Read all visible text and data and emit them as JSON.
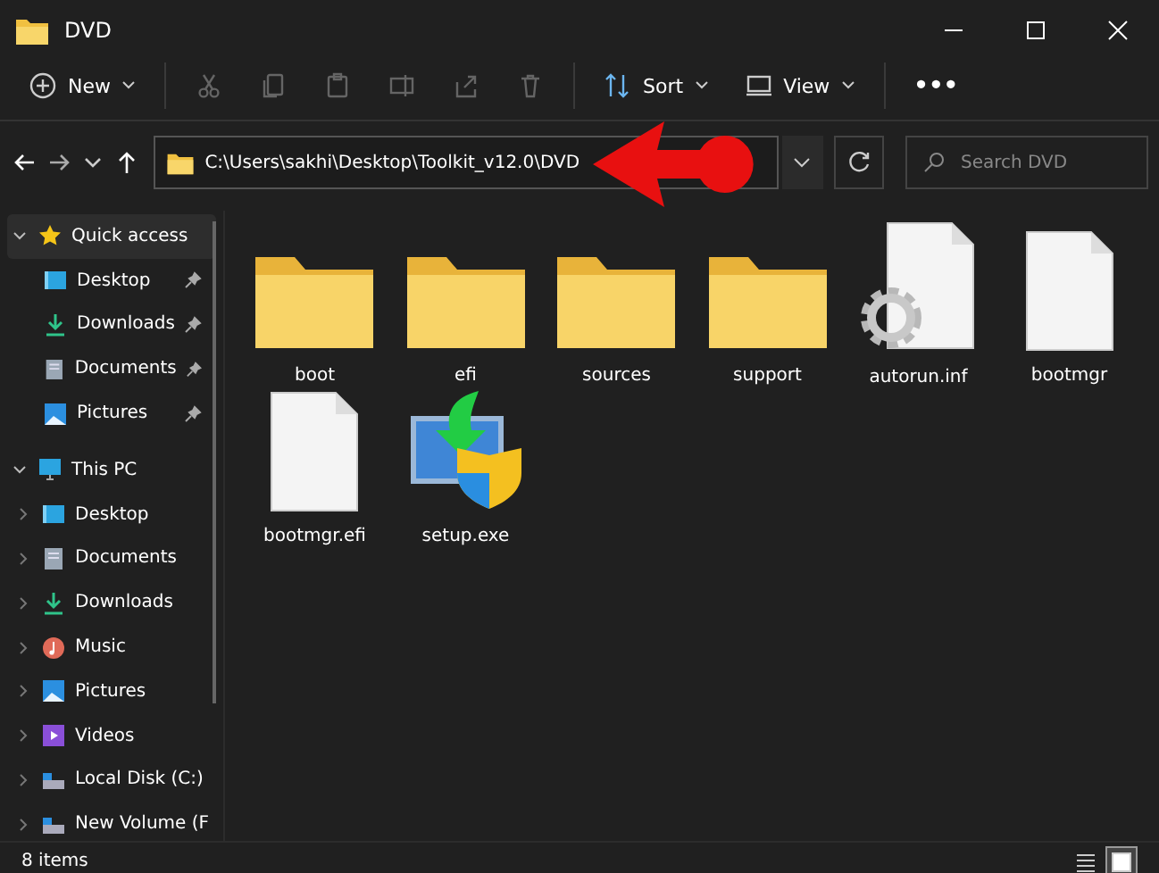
{
  "window": {
    "title": "DVD"
  },
  "toolbar": [
    {
      "kind": "new",
      "label": "New",
      "disabled": false
    },
    {
      "kind": "cut",
      "disabled": true
    },
    {
      "kind": "copy",
      "disabled": true
    },
    {
      "kind": "paste",
      "disabled": true
    },
    {
      "kind": "rename",
      "disabled": true
    },
    {
      "kind": "share",
      "disabled": true
    },
    {
      "kind": "delete",
      "disabled": true
    },
    {
      "kind": "sort",
      "label": "Sort",
      "disabled": false
    },
    {
      "kind": "view",
      "label": "View",
      "disabled": false
    },
    {
      "kind": "more",
      "label": "•••",
      "disabled": false
    }
  ],
  "address": {
    "path": "C:\\Users\\sakhi\\Desktop\\Toolkit_v12.0\\DVD"
  },
  "search": {
    "placeholder": "Search DVD"
  },
  "sidebar": [
    {
      "label": "Quick access",
      "kind": "star",
      "expanded": true,
      "selected": true,
      "children": [
        {
          "label": "Desktop",
          "kind": "desktop",
          "pinned": true,
          "selected": false
        },
        {
          "label": "Downloads",
          "kind": "download",
          "pinned": true,
          "selected": false
        },
        {
          "label": "Documents",
          "kind": "document",
          "pinned": true,
          "selected": false
        },
        {
          "label": "Pictures",
          "kind": "picture",
          "pinned": true,
          "selected": false
        }
      ]
    },
    {
      "label": "This PC",
      "kind": "pc",
      "expanded": true,
      "selected": false,
      "children": [
        {
          "label": "Desktop",
          "kind": "desktop",
          "expanded": false,
          "selected": false
        },
        {
          "label": "Documents",
          "kind": "document",
          "expanded": false,
          "selected": false
        },
        {
          "label": "Downloads",
          "kind": "download",
          "expanded": false,
          "selected": false
        },
        {
          "label": "Music",
          "kind": "music",
          "expanded": false,
          "selected": false
        },
        {
          "label": "Pictures",
          "kind": "picture",
          "expanded": false,
          "selected": false
        },
        {
          "label": "Videos",
          "kind": "video",
          "expanded": false,
          "selected": false
        },
        {
          "label": "Local Disk (C:)",
          "kind": "disk",
          "expanded": false,
          "selected": false
        },
        {
          "label": "New Volume (F",
          "kind": "disk",
          "expanded": false,
          "selected": false
        }
      ]
    }
  ],
  "files": [
    {
      "name": "boot",
      "kind": "folder"
    },
    {
      "name": "efi",
      "kind": "folder"
    },
    {
      "name": "sources",
      "kind": "folder"
    },
    {
      "name": "support",
      "kind": "folder"
    },
    {
      "name": "autorun.inf",
      "kind": "settings"
    },
    {
      "name": "bootmgr",
      "kind": "file"
    },
    {
      "name": "bootmgr.efi",
      "kind": "file"
    },
    {
      "name": "setup.exe",
      "kind": "installer"
    }
  ],
  "status_bar": {
    "count": "8 items",
    "views": [
      {
        "kind": "details",
        "selected": false
      },
      {
        "kind": "icons",
        "selected": true
      }
    ]
  }
}
